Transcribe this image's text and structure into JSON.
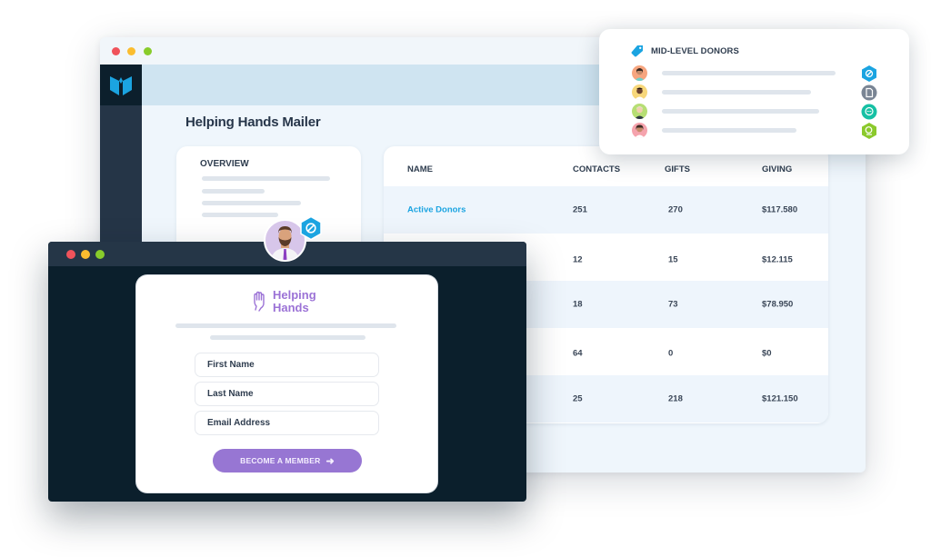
{
  "main_window": {
    "page_title": "Helping Hands Mailer",
    "logo_icon": "book-logo-icon",
    "overview": {
      "title": "OVERVIEW"
    },
    "table": {
      "columns": [
        "NAME",
        "CONTACTS",
        "GIFTS",
        "GIVING"
      ],
      "rows": [
        {
          "name": "Active Donors",
          "contacts": "251",
          "gifts": "270",
          "giving": "$117.580"
        },
        {
          "name": "",
          "contacts": "12",
          "gifts": "15",
          "giving": "$12.115"
        },
        {
          "name": "",
          "contacts": "18",
          "gifts": "73",
          "giving": "$78.950"
        },
        {
          "name": "",
          "contacts": "64",
          "gifts": "0",
          "giving": "$0"
        },
        {
          "name": "",
          "contacts": "25",
          "gifts": "218",
          "giving": "$121.150"
        }
      ]
    }
  },
  "donor_panel": {
    "title": "MID-LEVEL DONORS",
    "title_icon": "tag-icon",
    "donors": [
      {
        "avatar_bg": "#f6a57f",
        "badge_icon": "link-icon",
        "badge_color": "#1ba4e1"
      },
      {
        "avatar_bg": "#f7d77a",
        "badge_icon": "document-icon",
        "badge_color": "#7a8594"
      },
      {
        "avatar_bg": "#b7de74",
        "badge_icon": "chat-icon",
        "badge_color": "#16c0a4"
      },
      {
        "avatar_bg": "#f5a3ad",
        "badge_icon": "donation-icon",
        "badge_color": "#8bc92c"
      }
    ]
  },
  "signup_window": {
    "brand_line1": "Helping",
    "brand_line2": "Hands",
    "brand_icon": "hand-icon",
    "fields": {
      "first_name": "First Name",
      "last_name": "Last Name",
      "email": "Email Address"
    },
    "cta_label": "BECOME A MEMBER",
    "cta_icon": "arrow-right-icon"
  },
  "user": {
    "badge_icon": "link-icon"
  },
  "colors": {
    "accent_blue": "#1ba4e1",
    "accent_purple": "#9776d3",
    "sidebar_dark": "#253547",
    "window_dark": "#0b1f2c"
  }
}
